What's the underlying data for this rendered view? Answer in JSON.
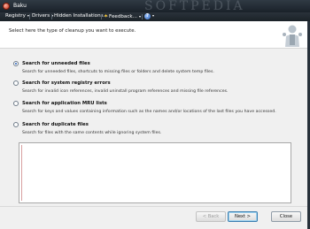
{
  "window": {
    "title": "Baku",
    "watermark": "SOFTPEDIA"
  },
  "menu": {
    "items": [
      {
        "label": "Registry"
      },
      {
        "label": "Drivers"
      },
      {
        "label": "Hidden Installations..."
      },
      {
        "label": "Feedback..."
      }
    ]
  },
  "header": {
    "instruction": "Select here the type of cleanup you want to execute."
  },
  "options": [
    {
      "title": "Search for unneeded files",
      "desc": "Search for unneeded files, shortcuts to missing files or folders and delete system temp files.",
      "selected": true
    },
    {
      "title": "Search for system registry errors",
      "desc": "Search for invalid icon references, invalid uninstall program references and missing file references.",
      "selected": false
    },
    {
      "title": "Search for application MRU lists",
      "desc": "Search for keys and values containing information such as the names and/or locations of the last files you have accessed.",
      "selected": false
    },
    {
      "title": "Search for duplicate files",
      "desc": "Search for files with the same contents while ignoring system files.",
      "selected": false
    }
  ],
  "buttons": {
    "back": "< Back",
    "next": "Next >",
    "close": "Close"
  },
  "colors": {
    "titlebar": "#1f272f",
    "accent": "#2a5fb8"
  }
}
